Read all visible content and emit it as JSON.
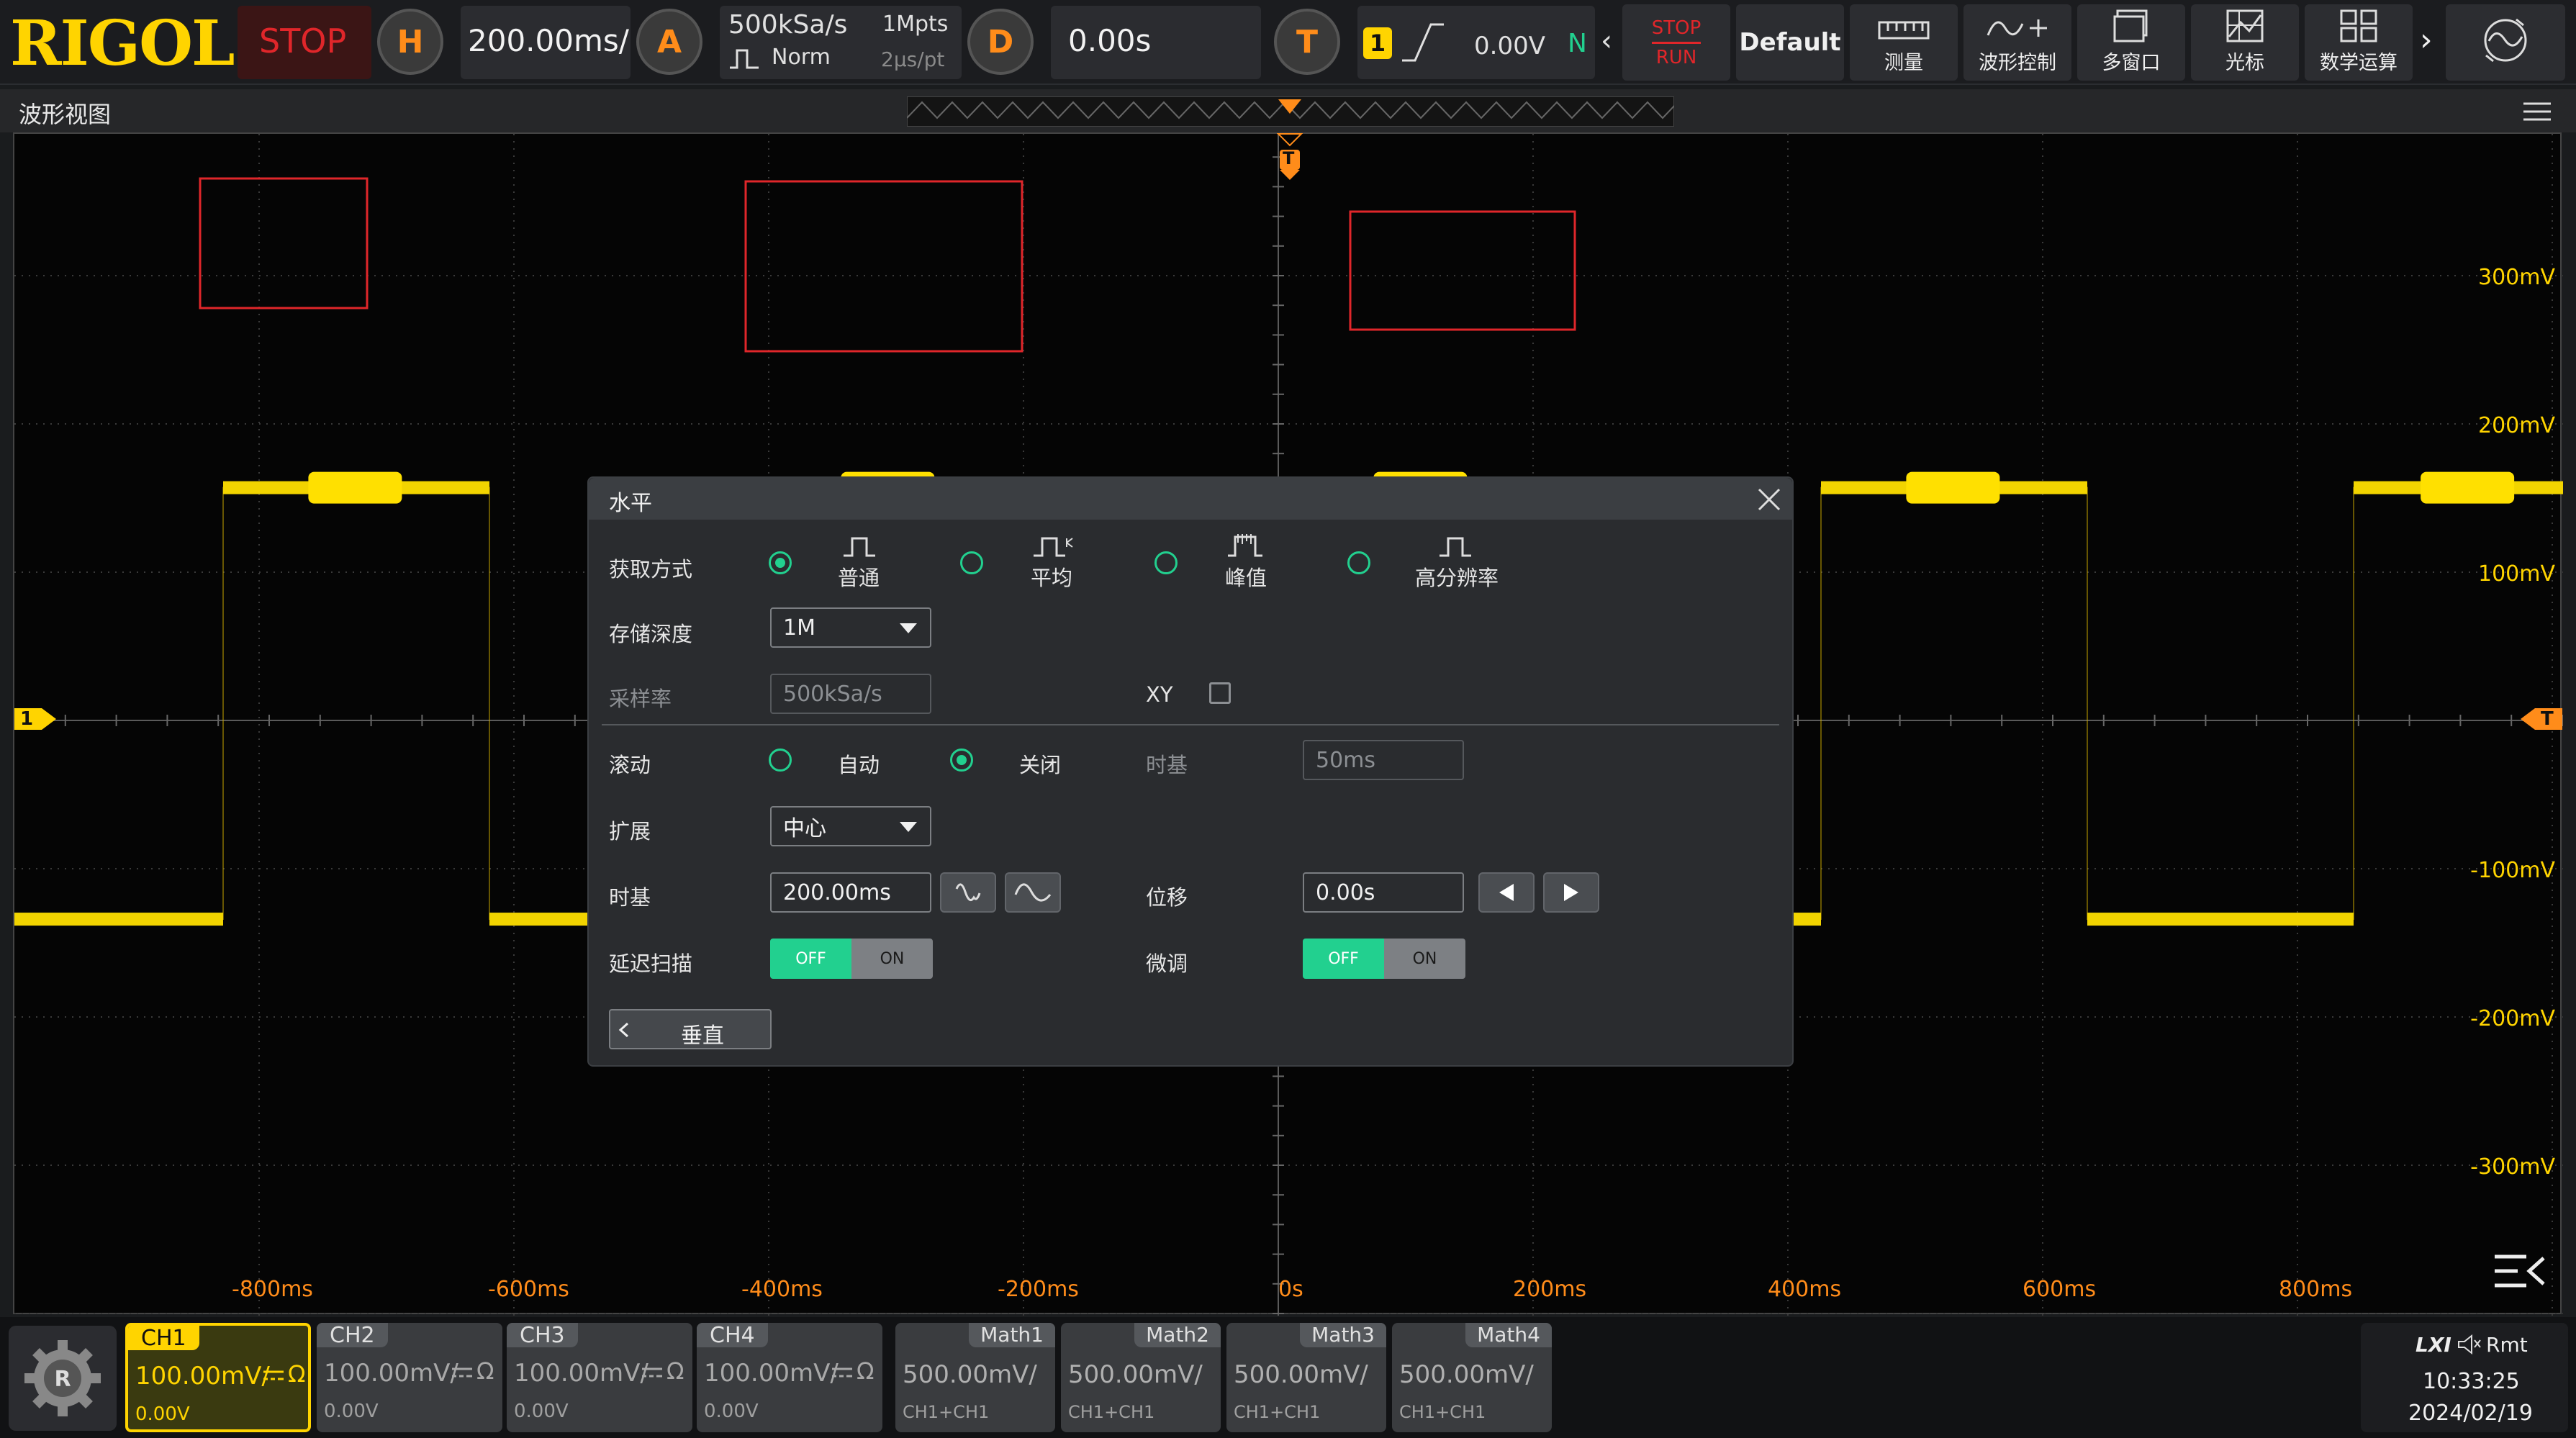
{
  "topbar": {
    "logo": "RIGOL",
    "run_state": "STOP",
    "horizontal": {
      "badge": "H",
      "timebase": "200.00ms/"
    },
    "acquire": {
      "badge": "A",
      "sample_rate": "500kSa/s",
      "depth": "1Mpts",
      "mode": "Norm",
      "time_per_point": "2μs/pt"
    },
    "delay": {
      "badge": "D",
      "value": "0.00s"
    },
    "trigger": {
      "badge": "T",
      "source": "1",
      "level": "0.00V",
      "mode": "N"
    },
    "stop_run": {
      "stop": "STOP",
      "run": "RUN"
    },
    "default_btn": "Default",
    "tools": [
      "测量",
      "波形控制",
      "多窗口",
      "光标",
      "数学运算"
    ]
  },
  "view": {
    "title": "波形视图",
    "y_labels": [
      "300mV",
      "200mV",
      "100mV",
      "-100mV",
      "-200mV",
      "-300mV"
    ],
    "x_labels": [
      "-800ms",
      "-600ms",
      "-400ms",
      "-200ms",
      "0s",
      "200ms",
      "400ms",
      "600ms",
      "800ms"
    ],
    "ch_marker": "1",
    "trig_marker": "T"
  },
  "dialog": {
    "title": "水平",
    "acq_label": "获取方式",
    "acq_options": [
      "普通",
      "平均",
      "峰值",
      "高分辨率"
    ],
    "acq_selected": "普通",
    "depth_label": "存储深度",
    "depth_value": "1M",
    "rate_label": "采样率",
    "rate_value": "500kSa/s",
    "xy_label": "XY",
    "roll_label": "滚动",
    "roll_auto": "自动",
    "roll_off": "关闭",
    "roll_selected": "关闭",
    "roll_timebase_label": "时基",
    "roll_timebase_value": "50ms",
    "expand_label": "扩展",
    "expand_value": "中心",
    "timebase_label": "时基",
    "timebase_value": "200.00ms",
    "position_label": "位移",
    "position_value": "0.00s",
    "delay_scan_label": "延迟扫描",
    "fine_label": "微调",
    "toggle_off": "OFF",
    "toggle_on": "ON",
    "back_button": "垂直"
  },
  "channels": [
    {
      "name": "CH1",
      "scale": "100.00mV/",
      "offset": "0.00V",
      "active": true
    },
    {
      "name": "CH2",
      "scale": "100.00mV/",
      "offset": "0.00V"
    },
    {
      "name": "CH3",
      "scale": "100.00mV/",
      "offset": "0.00V"
    },
    {
      "name": "CH4",
      "scale": "100.00mV/",
      "offset": "0.00V"
    }
  ],
  "channel_coupling_icon": "dc-coupling-icon",
  "channel_impedance": "Ω",
  "maths": [
    {
      "name": "Math1",
      "scale": "500.00mV/",
      "src": "CH1+CH1"
    },
    {
      "name": "Math2",
      "scale": "500.00mV/",
      "src": "CH1+CH1"
    },
    {
      "name": "Math3",
      "scale": "500.00mV/",
      "src": "CH1+CH1"
    },
    {
      "name": "Math4",
      "scale": "500.00mV/",
      "src": "CH1+CH1"
    }
  ],
  "status": {
    "lxi": "LXI",
    "rmt": "Rmt",
    "time": "10:33:25",
    "date": "2024/02/19"
  },
  "colors": {
    "ch1": "#ffd400",
    "accent": "#22d08f",
    "orange": "#ff8c1a",
    "stop": "#e0262a"
  }
}
